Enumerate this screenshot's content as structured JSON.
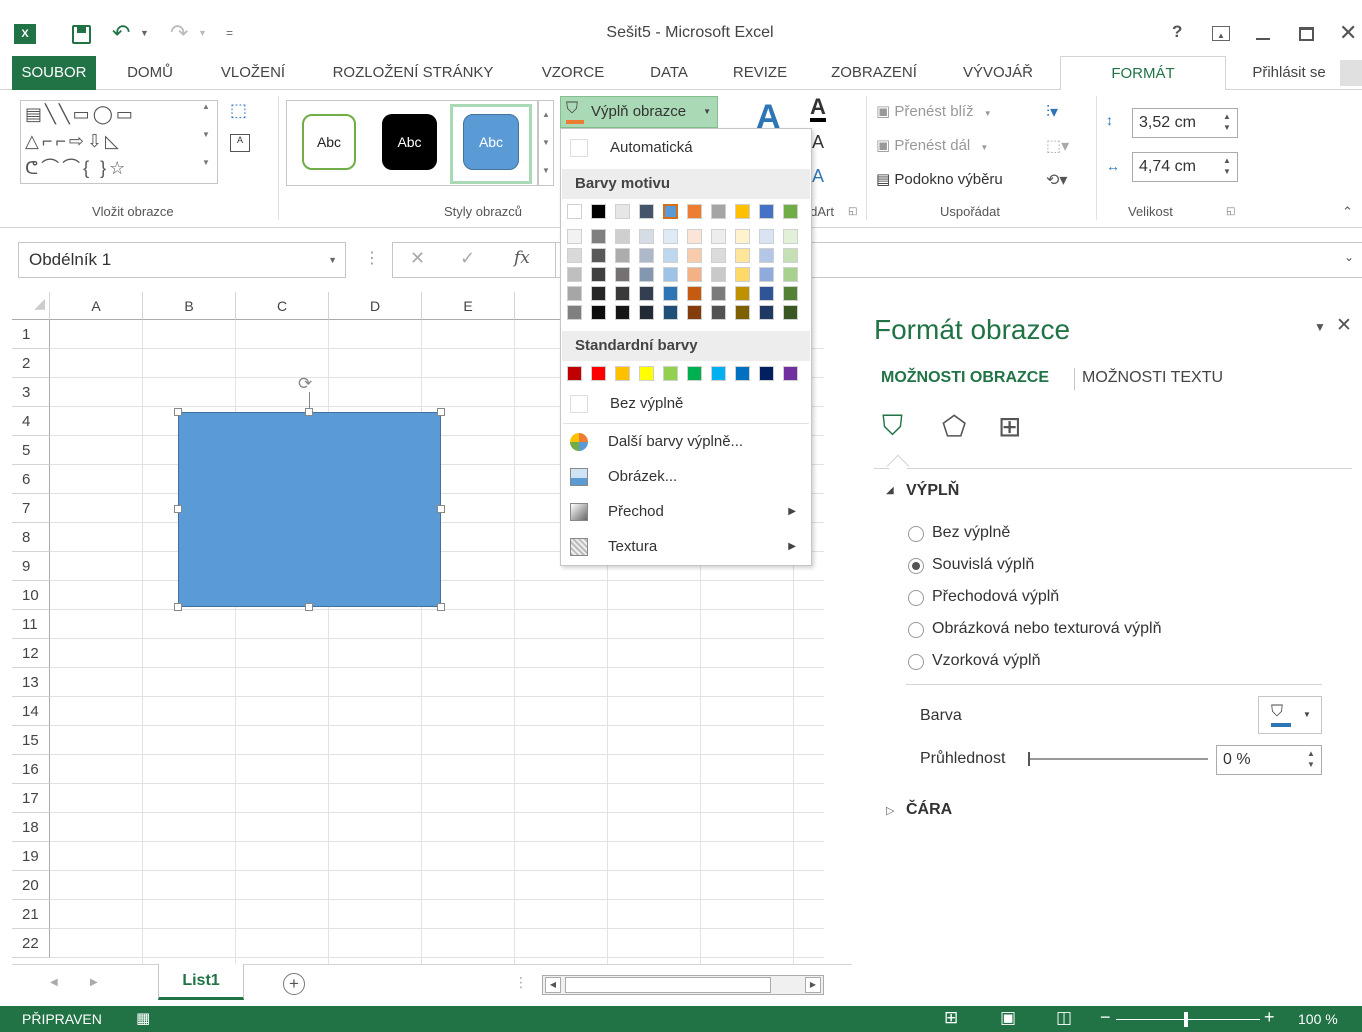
{
  "window": {
    "title": "Sešit5 - Microsoft Excel",
    "help": "?",
    "app_icon": "excel-icon"
  },
  "tabs": {
    "file": "SOUBOR",
    "home": "DOMŮ",
    "insert": "VLOŽENÍ",
    "page_layout": "ROZLOŽENÍ STRÁNKY",
    "formulas": "VZORCE",
    "data": "DATA",
    "review": "REVIZE",
    "view": "ZOBRAZENÍ",
    "developer": "VÝVOJÁŘ",
    "format": "FORMÁT",
    "signin": "Přihlásit se"
  },
  "ribbon": {
    "insert_shapes_label": "Vložit obrazce",
    "shape_styles_label": "Styly obrazců",
    "style_thumbs": [
      "Abc",
      "Abc",
      "Abc"
    ],
    "fill_button": "Výplň obrazce",
    "wordart_label": "WordArt",
    "bring_forward": "Přenést blíž",
    "send_backward": "Přenést dál",
    "selection_pane": "Podokno výběru",
    "arrange_label": "Uspořádat",
    "height": "3,52 cm",
    "width": "4,74 cm",
    "size_label": "Velikost"
  },
  "formula_bar": {
    "name_box": "Obdélník 1",
    "fx": "fx"
  },
  "sheet": {
    "columns": [
      "A",
      "B",
      "C",
      "D",
      "E"
    ],
    "rows": [
      "1",
      "2",
      "3",
      "4",
      "5",
      "6",
      "7",
      "8",
      "9",
      "10",
      "11",
      "12",
      "13",
      "14",
      "15",
      "16",
      "17",
      "18",
      "19",
      "20",
      "21",
      "22"
    ],
    "shape_color": "#5b9bd5"
  },
  "fill_menu": {
    "automatic": "Automatická",
    "theme_colors": "Barvy motivu",
    "standard_colors": "Standardní barvy",
    "no_fill": "Bez výplně",
    "more_colors": "Další barvy výplně...",
    "picture": "Obrázek...",
    "gradient": "Přechod",
    "texture": "Textura",
    "theme_row": [
      "#ffffff",
      "#000000",
      "#e7e6e6",
      "#44546a",
      "#5b9bd5",
      "#ed7d31",
      "#a5a5a5",
      "#ffc000",
      "#4472c4",
      "#70ad47"
    ],
    "theme_shades": [
      [
        "#f2f2f2",
        "#d9d9d9",
        "#bfbfbf",
        "#a6a6a6",
        "#808080"
      ],
      [
        "#7f7f7f",
        "#595959",
        "#404040",
        "#262626",
        "#0d0d0d"
      ],
      [
        "#d0cece",
        "#aeabab",
        "#757171",
        "#3a3838",
        "#171616"
      ],
      [
        "#d6dce5",
        "#adb9ca",
        "#8497b0",
        "#333f50",
        "#222a35"
      ],
      [
        "#deebf7",
        "#bdd7ee",
        "#9dc3e6",
        "#2e75b6",
        "#1f4e79"
      ],
      [
        "#fbe5d6",
        "#f8cbad",
        "#f4b183",
        "#c55a11",
        "#843c0c"
      ],
      [
        "#ededed",
        "#dbdbdb",
        "#c9c9c9",
        "#7b7b7b",
        "#525252"
      ],
      [
        "#fff2cc",
        "#ffe699",
        "#ffd966",
        "#bf9000",
        "#7f6000"
      ],
      [
        "#dae3f3",
        "#b4c7e7",
        "#8faadc",
        "#2f5597",
        "#203864"
      ],
      [
        "#e2f0d9",
        "#c5e0b4",
        "#a9d18e",
        "#548235",
        "#385723"
      ]
    ],
    "standard_row": [
      "#c00000",
      "#ff0000",
      "#ffc000",
      "#ffff00",
      "#92d050",
      "#00b050",
      "#00b0f0",
      "#0070c0",
      "#002060",
      "#7030a0"
    ]
  },
  "pane": {
    "title": "Formát obrazce",
    "tab_shape": "MOŽNOSTI OBRAZCE",
    "tab_text": "MOŽNOSTI TEXTU",
    "fill_section": "VÝPLŇ",
    "opt_none": "Bez výplně",
    "opt_solid": "Souvislá výplň",
    "opt_gradient": "Přechodová výplň",
    "opt_picture": "Obrázková nebo texturová výplň",
    "opt_pattern": "Vzorková výplň",
    "color_label": "Barva",
    "transparency_label": "Průhlednost",
    "transparency_value": "0 %",
    "transparency_fraction": 0,
    "line_section": "ČÁRA"
  },
  "sheet_tabs": {
    "active": "List1"
  },
  "status": {
    "ready": "PŘIPRAVEN",
    "zoom": "100 %"
  },
  "colors": {
    "accent": "#217346",
    "format_tab": "#217346",
    "highlight": "#a9d9b5"
  }
}
